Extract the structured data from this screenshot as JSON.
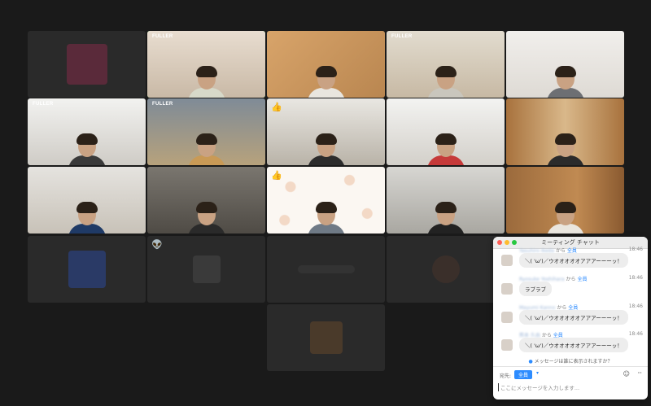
{
  "brand_tag": "FULLER",
  "reaction_icons": {
    "thumbs": "thumbs-up-emoji",
    "alien": "alien-emoji"
  },
  "chat": {
    "title": "ミーティング チャット",
    "messages": [
      {
        "sender": "Yasuhiro Ikeda",
        "connector": "から",
        "to": "全員",
        "time": "18:46",
        "text": "＼( 'ω')／ウオオオオオアアアーーーッ！"
      },
      {
        "sender": "Ryosuke Yoshihara",
        "connector": "から",
        "to": "全員",
        "time": "18:46",
        "text": "ラブラブ"
      },
      {
        "sender": "Mayumi Kanno",
        "connector": "から",
        "to": "全員",
        "time": "18:46",
        "text": "＼( 'ω')／ウオオオオオアアアーーーッ！"
      },
      {
        "sender": "熊本 久由",
        "connector": "から",
        "to": "全員",
        "time": "18:46",
        "text": "＼( 'ω')／ウオオオオオアアアーーーッ！"
      }
    ],
    "visibility_notice": "メッセージは誰に表示されますか？",
    "recipient_label": "宛先:",
    "recipient_value": "全員",
    "input_placeholder": "ここにメッセージを入力します..."
  },
  "colors": {
    "active_speaker": "#27c93f",
    "chat_accent": "#2d8cff",
    "background": "#1a1a1a"
  }
}
